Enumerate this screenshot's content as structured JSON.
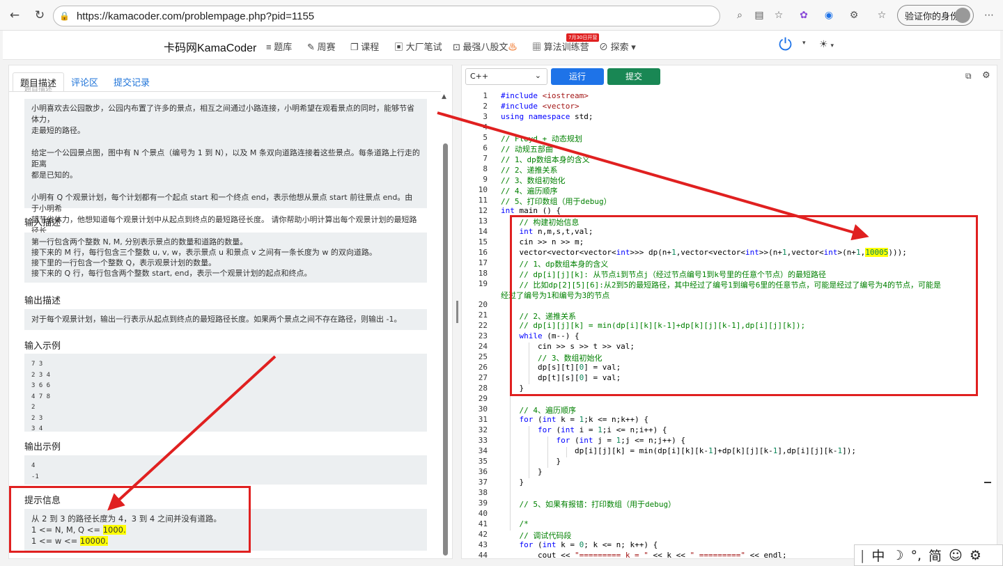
{
  "browser": {
    "url": "https://kamacoder.com/problempage.php?pid=1155",
    "profile_label": "验证你的身份"
  },
  "site_nav": {
    "brand": "卡码网KamaCoder",
    "items": [
      "题库",
      "周赛",
      "课程",
      "大厂笔试",
      "最强八股文",
      "算法训练营",
      "探索"
    ],
    "badge": "7月30日开营"
  },
  "tabs": [
    "题目描述",
    "评论区",
    "提交记录"
  ],
  "problem": {
    "desc_cut": "题目描述",
    "desc": [
      "小明喜欢去公园散步，公园内布置了许多的景点，相互之间通过小路连接，小明希望在观看景点的同时，能够节省体力，",
      "走最短的路径。",
      "",
      "给定一个公园景点图，图中有 N 个景点（编号为 1 到 N），以及 M 条双向道路连接着这些景点。每条道路上行走的距离",
      "都是已知的。",
      "",
      "小明有 Q 个观景计划，每个计划都有一个起点 start 和一个终点 end，表示他想从景点 start 前往景点 end。由于小明希",
      "望节省体力，他想知道每个观景计划中从起点到终点的最短路径长度。 请你帮助小明计算出每个观景计划的最短路径长",
      "度。"
    ],
    "input_title": "输入描述",
    "input_desc": [
      "第一行包含两个整数 N, M, 分别表示景点的数量和道路的数量。",
      "接下来的 M 行，每行包含三个整数 u, v, w，表示景点 u 和景点 v 之间有一条长度为 w 的双向道路。",
      "接下里的一行包含一个整数 Q，表示观景计划的数量。",
      "接下来的 Q 行，每行包含两个整数 start, end，表示一个观景计划的起点和终点。"
    ],
    "output_title": "输出描述",
    "output_desc": "对于每个观景计划，输出一行表示从起点到终点的最短路径长度。如果两个景点之间不存在路径，则输出 -1。",
    "sample_in_title": "输入示例",
    "sample_in": "7 3\n2 3 4\n3 6 6\n4 7 8\n2\n2 3\n3 4",
    "sample_out_title": "输出示例",
    "sample_out": "4\n-1",
    "hint_title": "提示信息",
    "hint_line1": "从 2 到 3 的路径长度为 4，3 到 4 之间并没有道路。",
    "hint_line2_pre": "1 <= N, M, Q <= ",
    "hint_line2_val": "1000.",
    "hint_line3_pre": "1 <= w <= ",
    "hint_line3_val": "10000."
  },
  "editor": {
    "language": "C++",
    "run_label": "运行",
    "submit_label": "提交"
  },
  "ime": {
    "items": [
      "中",
      "☽",
      "°,",
      "简",
      "☺",
      "⚙"
    ]
  }
}
